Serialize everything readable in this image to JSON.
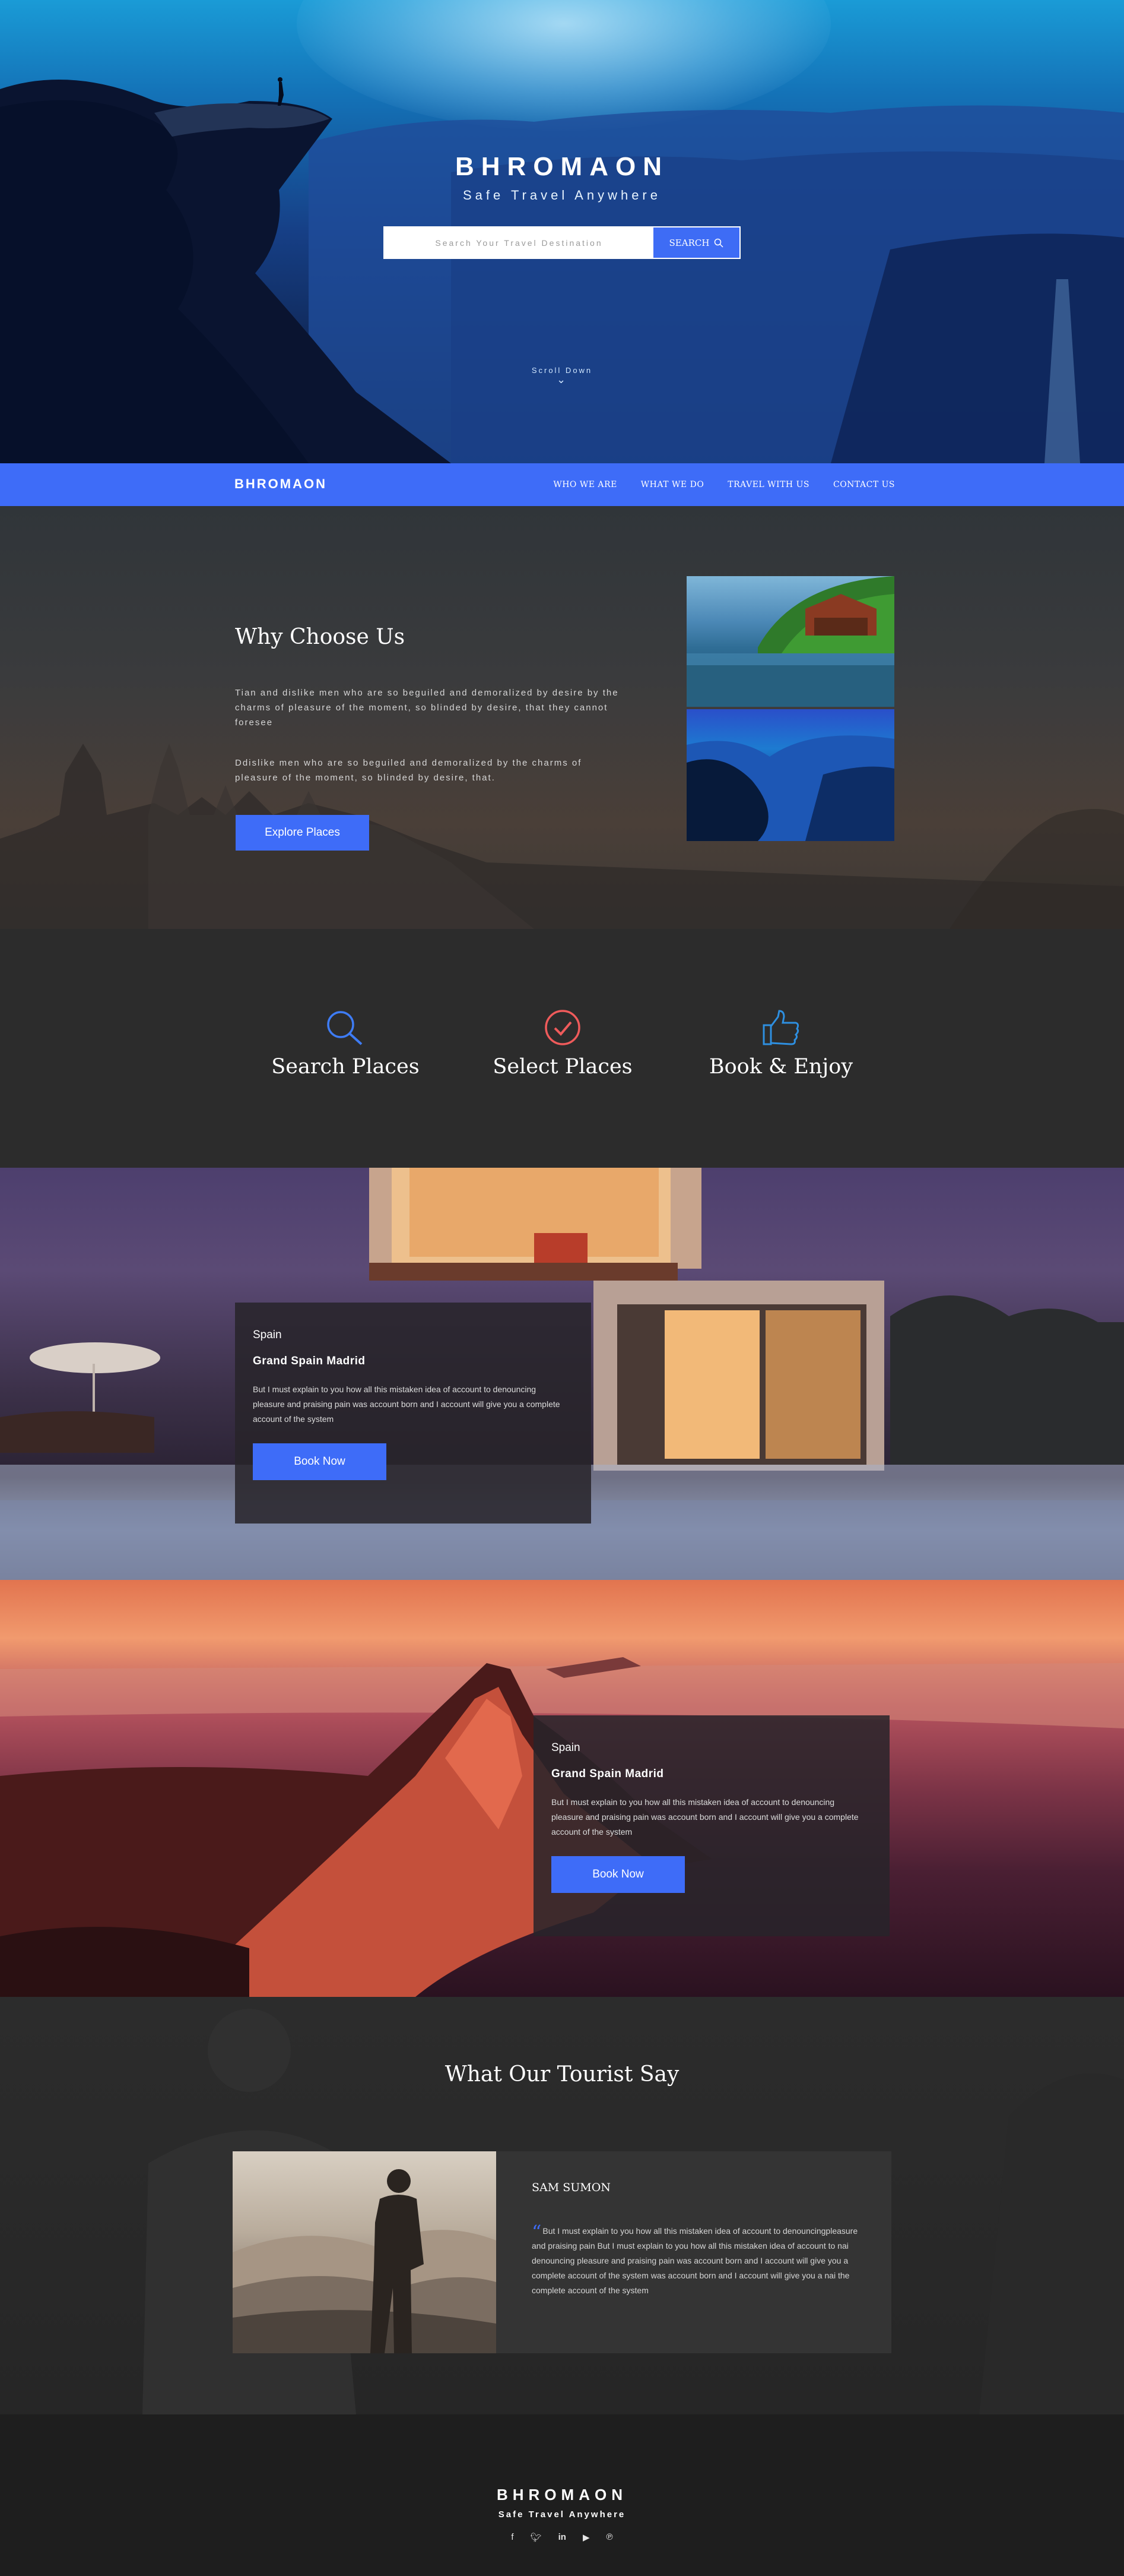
{
  "brand": {
    "name": "BHROMAON",
    "tagline": "Safe Travel Anywhere"
  },
  "hero": {
    "search_placeholder": "Search Your Travel Destination",
    "search_button": "SEARCH",
    "scroll_label": "Scroll Down"
  },
  "nav": {
    "logo": "BHROMAON",
    "links": [
      "WHO WE ARE",
      "WHAT WE DO",
      "TRAVEL WITH US",
      "CONTACT US"
    ]
  },
  "why": {
    "title": "Why Choose Us",
    "para1": "Tian and dislike men who are so beguiled and demoralized by desire by the charms of pleasure of the moment, so blinded by desire, that they cannot foresee",
    "para2": "Ddislike men who are so beguiled and demoralized by the charms of pleasure of the moment, so blinded by desire, that.",
    "button": "Explore Places"
  },
  "features": [
    {
      "label": "Search Places",
      "icon": "search-icon",
      "color": "#3e7cf5"
    },
    {
      "label": "Select Places",
      "icon": "check-circle-icon",
      "color": "#ef5b5b"
    },
    {
      "label": "Book & Enjoy",
      "icon": "thumbs-up-icon",
      "color": "#2e8fe0"
    }
  ],
  "promos": [
    {
      "country": "Spain",
      "place": "Grand Spain Madrid",
      "text": "But I must explain to you how all this mistaken idea of account to denouncing pleasure and praising pain was account born and I account will give you a complete account of the system",
      "button": "Book Now"
    },
    {
      "country": "Spain",
      "place": "Grand Spain Madrid",
      "text": "But I must explain to you how all this mistaken idea of account to denouncing pleasure and praising pain was account born and I account will give you a complete account of the system",
      "button": "Book Now"
    }
  ],
  "testimonials": {
    "title": "What Our Tourist Say",
    "name": "SAM SUMON",
    "quote": "But I must explain to you how all this mistaken idea of account to denouncingpleasure and praising pain But I must explain to you how all this mistaken idea of account to nai denouncing pleasure and praising pain was account born and I account will give you a complete account of the system was account born and I account will give you a nai the complete account of the system"
  },
  "footer": {
    "brand": "BHROMAON",
    "tagline": "Safe Travel Anywhere",
    "social": [
      "facebook-icon",
      "twitter-icon",
      "linkedin-icon",
      "youtube-icon",
      "pinterest-icon"
    ]
  },
  "colors": {
    "accent": "#3e6cf8",
    "dark": "#2c2c2c",
    "footer": "#1e1e1e"
  }
}
